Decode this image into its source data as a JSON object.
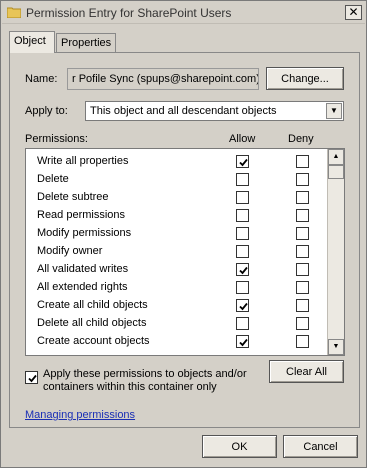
{
  "window": {
    "title": "Permission Entry for SharePoint Users"
  },
  "tabs": [
    {
      "label": "Object"
    },
    {
      "label": "Properties"
    }
  ],
  "name": {
    "label": "Name:",
    "value": "r Pofile Sync (spups@sharepoint.com)",
    "change_button": "Change..."
  },
  "apply_to": {
    "label": "Apply to:",
    "value": "This object and all descendant objects"
  },
  "permissions": {
    "header": "Permissions:",
    "allow_header": "Allow",
    "deny_header": "Deny",
    "items": [
      {
        "label": "Write all properties",
        "allow": true,
        "deny": false
      },
      {
        "label": "Delete",
        "allow": false,
        "deny": false
      },
      {
        "label": "Delete subtree",
        "allow": false,
        "deny": false
      },
      {
        "label": "Read permissions",
        "allow": false,
        "deny": false
      },
      {
        "label": "Modify permissions",
        "allow": false,
        "deny": false
      },
      {
        "label": "Modify owner",
        "allow": false,
        "deny": false
      },
      {
        "label": "All validated writes",
        "allow": true,
        "deny": false
      },
      {
        "label": "All extended rights",
        "allow": false,
        "deny": false
      },
      {
        "label": "Create all child objects",
        "allow": true,
        "deny": false
      },
      {
        "label": "Delete all child objects",
        "allow": false,
        "deny": false
      },
      {
        "label": "Create account objects",
        "allow": true,
        "deny": false
      }
    ]
  },
  "apply_checkbox": {
    "checked": true,
    "line1": "Apply these permissions to objects and/or",
    "line2": "containers within this container only"
  },
  "clear_all_button": "Clear All",
  "managing_link": "Managing permissions",
  "footer": {
    "ok_label": "OK",
    "cancel_label": "Cancel"
  }
}
